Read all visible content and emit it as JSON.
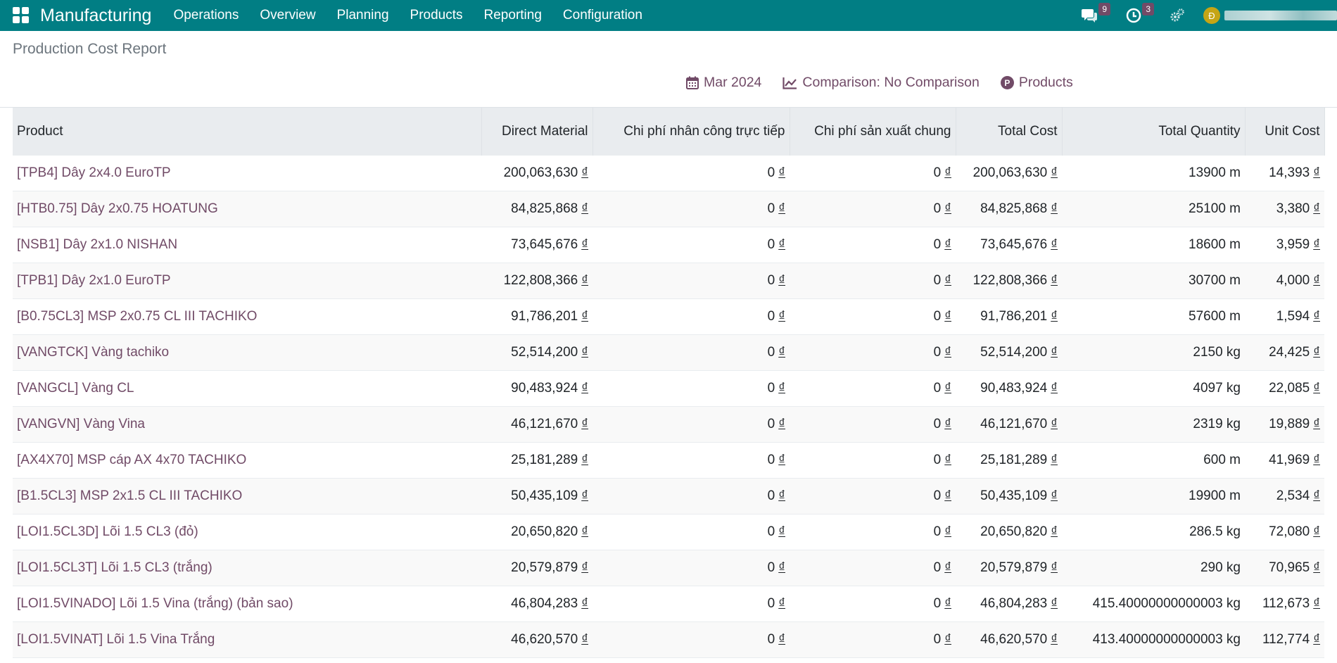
{
  "navbar": {
    "brand": "Manufacturing",
    "menu": [
      "Operations",
      "Overview",
      "Planning",
      "Products",
      "Reporting",
      "Configuration"
    ],
    "messages_count": "9",
    "activities_count": "3",
    "avatar_initial": "Đ",
    "bg_color": "#017e84"
  },
  "breadcrumb": "Production Cost Report",
  "filters": {
    "date": "Mar 2024",
    "comparison": "Comparison: No Comparison",
    "products": "Products",
    "products_badge": "P"
  },
  "table": {
    "headers": [
      "Product",
      "Direct Material",
      "Chi phí nhân công trực tiếp",
      "Chi phí sản xuất chung",
      "Total Cost",
      "Total Quantity",
      "Unit Cost"
    ],
    "currency": "₫",
    "rows": [
      {
        "product": "[TPB4] Dây 2x4.0 EuroTP",
        "direct": "200,063,630",
        "labor": "0",
        "overhead": "0",
        "total": "200,063,630",
        "qty": "13900 m",
        "unit": "14,393"
      },
      {
        "product": "[HTB0.75] Dây 2x0.75 HOATUNG",
        "direct": "84,825,868",
        "labor": "0",
        "overhead": "0",
        "total": "84,825,868",
        "qty": "25100 m",
        "unit": "3,380"
      },
      {
        "product": "[NSB1] Dây 2x1.0 NISHAN",
        "direct": "73,645,676",
        "labor": "0",
        "overhead": "0",
        "total": "73,645,676",
        "qty": "18600 m",
        "unit": "3,959"
      },
      {
        "product": "[TPB1] Dây 2x1.0 EuroTP",
        "direct": "122,808,366",
        "labor": "0",
        "overhead": "0",
        "total": "122,808,366",
        "qty": "30700 m",
        "unit": "4,000"
      },
      {
        "product": "[B0.75CL3] MSP 2x0.75 CL III TACHIKO",
        "direct": "91,786,201",
        "labor": "0",
        "overhead": "0",
        "total": "91,786,201",
        "qty": "57600 m",
        "unit": "1,594"
      },
      {
        "product": "[VANGTCK] Vàng tachiko",
        "direct": "52,514,200",
        "labor": "0",
        "overhead": "0",
        "total": "52,514,200",
        "qty": "2150 kg",
        "unit": "24,425"
      },
      {
        "product": "[VANGCL] Vàng CL",
        "direct": "90,483,924",
        "labor": "0",
        "overhead": "0",
        "total": "90,483,924",
        "qty": "4097 kg",
        "unit": "22,085"
      },
      {
        "product": "[VANGVN] Vàng Vina",
        "direct": "46,121,670",
        "labor": "0",
        "overhead": "0",
        "total": "46,121,670",
        "qty": "2319 kg",
        "unit": "19,889"
      },
      {
        "product": "[AX4X70] MSP cáp AX 4x70 TACHIKO",
        "direct": "25,181,289",
        "labor": "0",
        "overhead": "0",
        "total": "25,181,289",
        "qty": "600 m",
        "unit": "41,969"
      },
      {
        "product": "[B1.5CL3] MSP 2x1.5 CL III TACHIKO",
        "direct": "50,435,109",
        "labor": "0",
        "overhead": "0",
        "total": "50,435,109",
        "qty": "19900 m",
        "unit": "2,534"
      },
      {
        "product": "[LOI1.5CL3D] Lõi 1.5 CL3 (đỏ)",
        "direct": "20,650,820",
        "labor": "0",
        "overhead": "0",
        "total": "20,650,820",
        "qty": "286.5 kg",
        "unit": "72,080"
      },
      {
        "product": "[LOI1.5CL3T] Lõi 1.5 CL3 (trắng)",
        "direct": "20,579,879",
        "labor": "0",
        "overhead": "0",
        "total": "20,579,879",
        "qty": "290 kg",
        "unit": "70,965"
      },
      {
        "product": "[LOI1.5VINADO] Lõi 1.5 Vina (trắng) (bản sao)",
        "direct": "46,804,283",
        "labor": "0",
        "overhead": "0",
        "total": "46,804,283",
        "qty": "415.40000000000003 kg",
        "unit": "112,673"
      },
      {
        "product": "[LOI1.5VINAT] Lõi 1.5 Vina Trắng",
        "direct": "46,620,570",
        "labor": "0",
        "overhead": "0",
        "total": "46,620,570",
        "qty": "413.40000000000003 kg",
        "unit": "112,774"
      }
    ]
  }
}
